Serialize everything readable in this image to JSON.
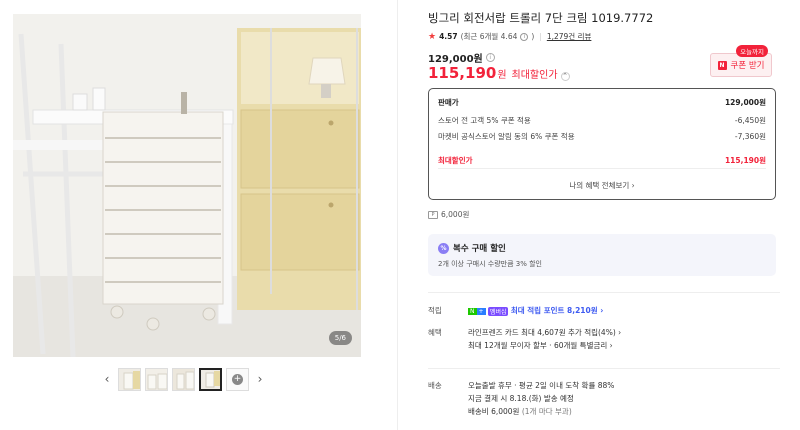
{
  "gallery": {
    "counter": "5/6",
    "prev_arrow": "‹",
    "next_arrow": "›",
    "more_icon": "+"
  },
  "product": {
    "title": "빙그리 회전서랍 트롤리 7단 크림 1019.7772",
    "rating_score": "4.57",
    "rating_detail": "(최근 6개월 4.64",
    "rating_detail_close": ")",
    "review_count": "1,279건 리뷰",
    "original_price": "129,000원",
    "sale_price_num": "115,190",
    "sale_price_unit": "원",
    "sale_label": "최대할인가"
  },
  "coupon": {
    "tag": "오늘까지",
    "logo": "N",
    "label": "쿠폰 받기"
  },
  "price_box": {
    "rows": [
      {
        "label": "판매가",
        "value": "129,000원"
      },
      {
        "label": "스토어 전 고객 5% 쿠폰 적용",
        "value": "-6,450원"
      },
      {
        "label": "마켓비 공식스토어 알림 동의 6% 쿠폰 적용",
        "value": "-7,360원"
      },
      {
        "label": "최대할인가",
        "value": "115,190원"
      }
    ],
    "all_benefits": "나의 혜택 전체보기 ›"
  },
  "points": {
    "icon": "P",
    "text": "6,000원"
  },
  "bulk": {
    "icon": "%",
    "title": "복수 구매 할인",
    "desc": "2개 이상 구매시 수량만큼 3% 할인"
  },
  "benefits": {
    "accum_label": "적립",
    "accum_badge_n": "N",
    "accum_badge_p": "+",
    "accum_badge_m": "멤버십",
    "accum_text": "최대 적립 포인트 8,210원 ›",
    "perk_label": "혜택",
    "perk_line1": "라인프렌즈 카드 최대 4,607원 추가 적립(4%) ›",
    "perk_line2": "최대 12개월 무이자 할부 · 60개월 특별금리 ›",
    "ship_label": "배송",
    "ship_line1": "오늘출발 휴무 · 평균 2일 이내 도착 확률 88%",
    "ship_line2": "지금 결제 시 8.18.(화) 발송 예정",
    "ship_line3_a": "배송비 6,000원",
    "ship_line3_b": "(1개 마다 부과)"
  }
}
